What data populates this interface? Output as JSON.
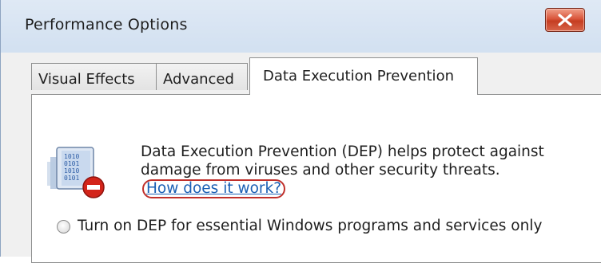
{
  "window": {
    "title": "Performance Options"
  },
  "tabs": [
    {
      "label": "Visual Effects",
      "active": false
    },
    {
      "label": "Advanced",
      "active": false
    },
    {
      "label": "Data Execution Prevention",
      "active": true
    }
  ],
  "dep": {
    "description": "Data Execution Prevention (DEP) helps protect against damage from viruses and other security threats.",
    "link_label": "How does it work?",
    "icon": "dep-shield-icon"
  },
  "options": {
    "essential_label": "Turn on DEP for essential Windows programs and services only",
    "essential_selected": false
  },
  "colors": {
    "link": "#1a5fb4",
    "close_button": "#c53e22",
    "highlight_ring": "#c0302b"
  }
}
